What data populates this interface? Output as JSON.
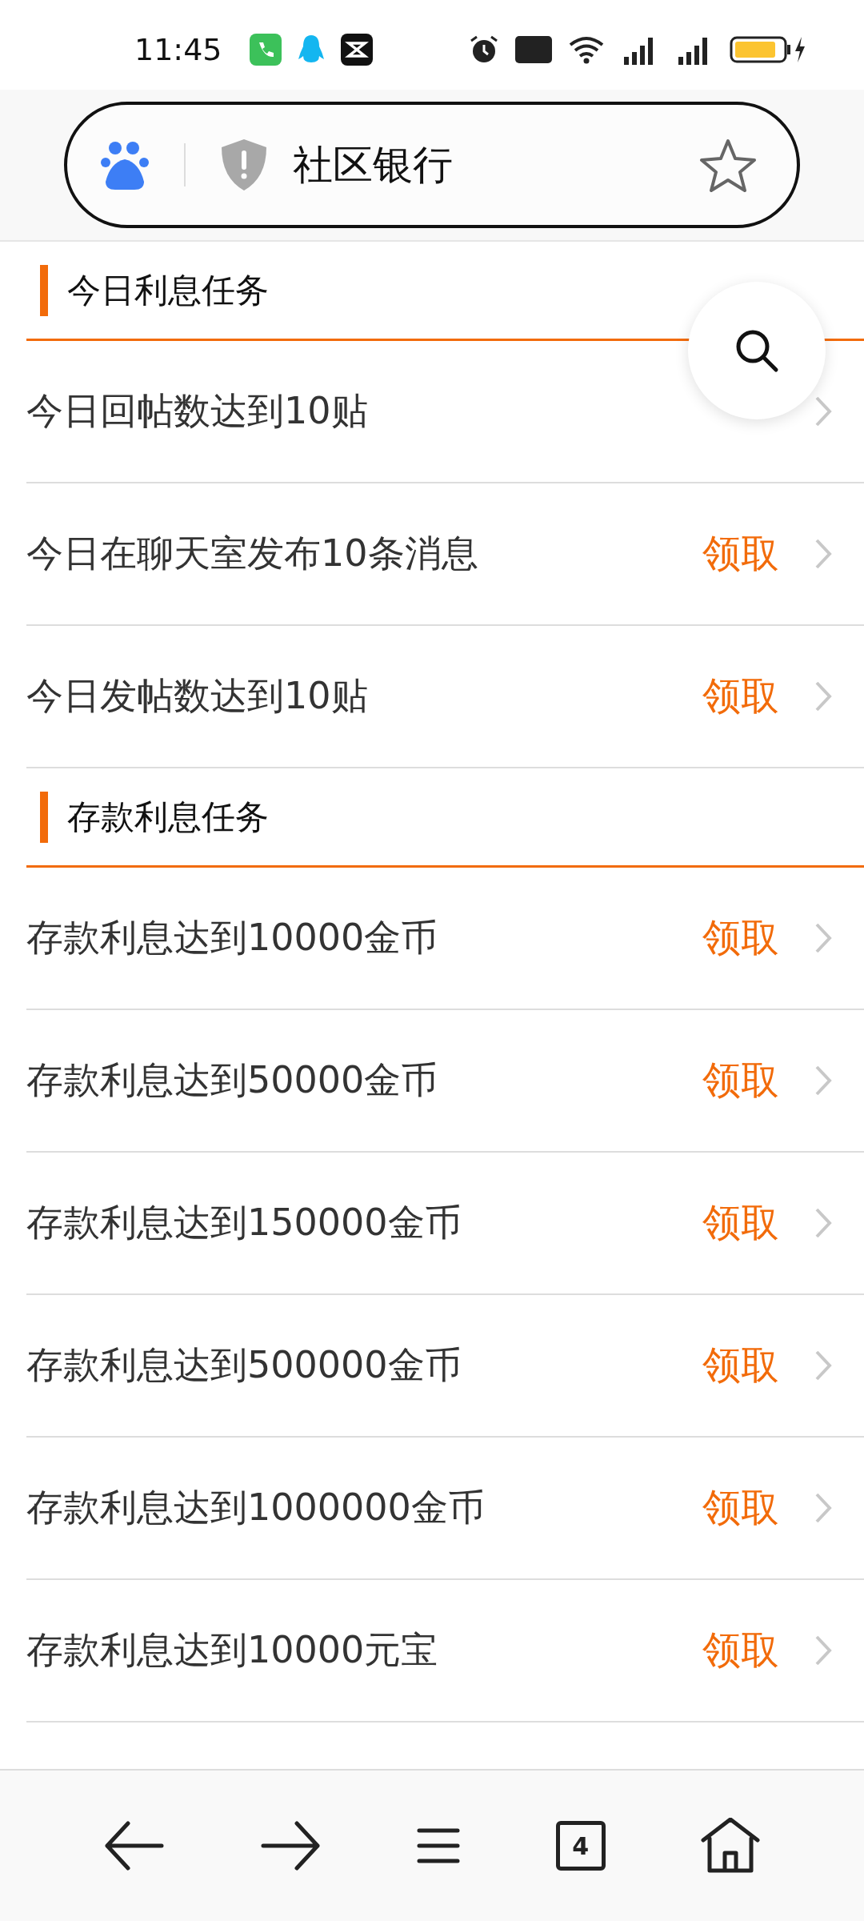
{
  "status_bar": {
    "time": "11:45"
  },
  "address_bar": {
    "title": "社区银行"
  },
  "sections": [
    {
      "title": "今日利息任务",
      "tasks": [
        {
          "label": "今日回帖数达到10贴"
        },
        {
          "label": "今日在聊天室发布10条消息",
          "action": "领取"
        },
        {
          "label": "今日发帖数达到10贴",
          "action": "领取"
        }
      ]
    },
    {
      "title": "存款利息任务",
      "tasks": [
        {
          "label": "存款利息达到10000金币",
          "action": "领取"
        },
        {
          "label": "存款利息达到50000金币",
          "action": "领取"
        },
        {
          "label": "存款利息达到150000金币",
          "action": "领取"
        },
        {
          "label": "存款利息达到500000金币",
          "action": "领取"
        },
        {
          "label": "存款利息达到1000000金币",
          "action": "领取"
        },
        {
          "label": "存款利息达到10000元宝",
          "action": "领取"
        }
      ]
    }
  ],
  "bottom_bar": {
    "tab_count": "4"
  }
}
